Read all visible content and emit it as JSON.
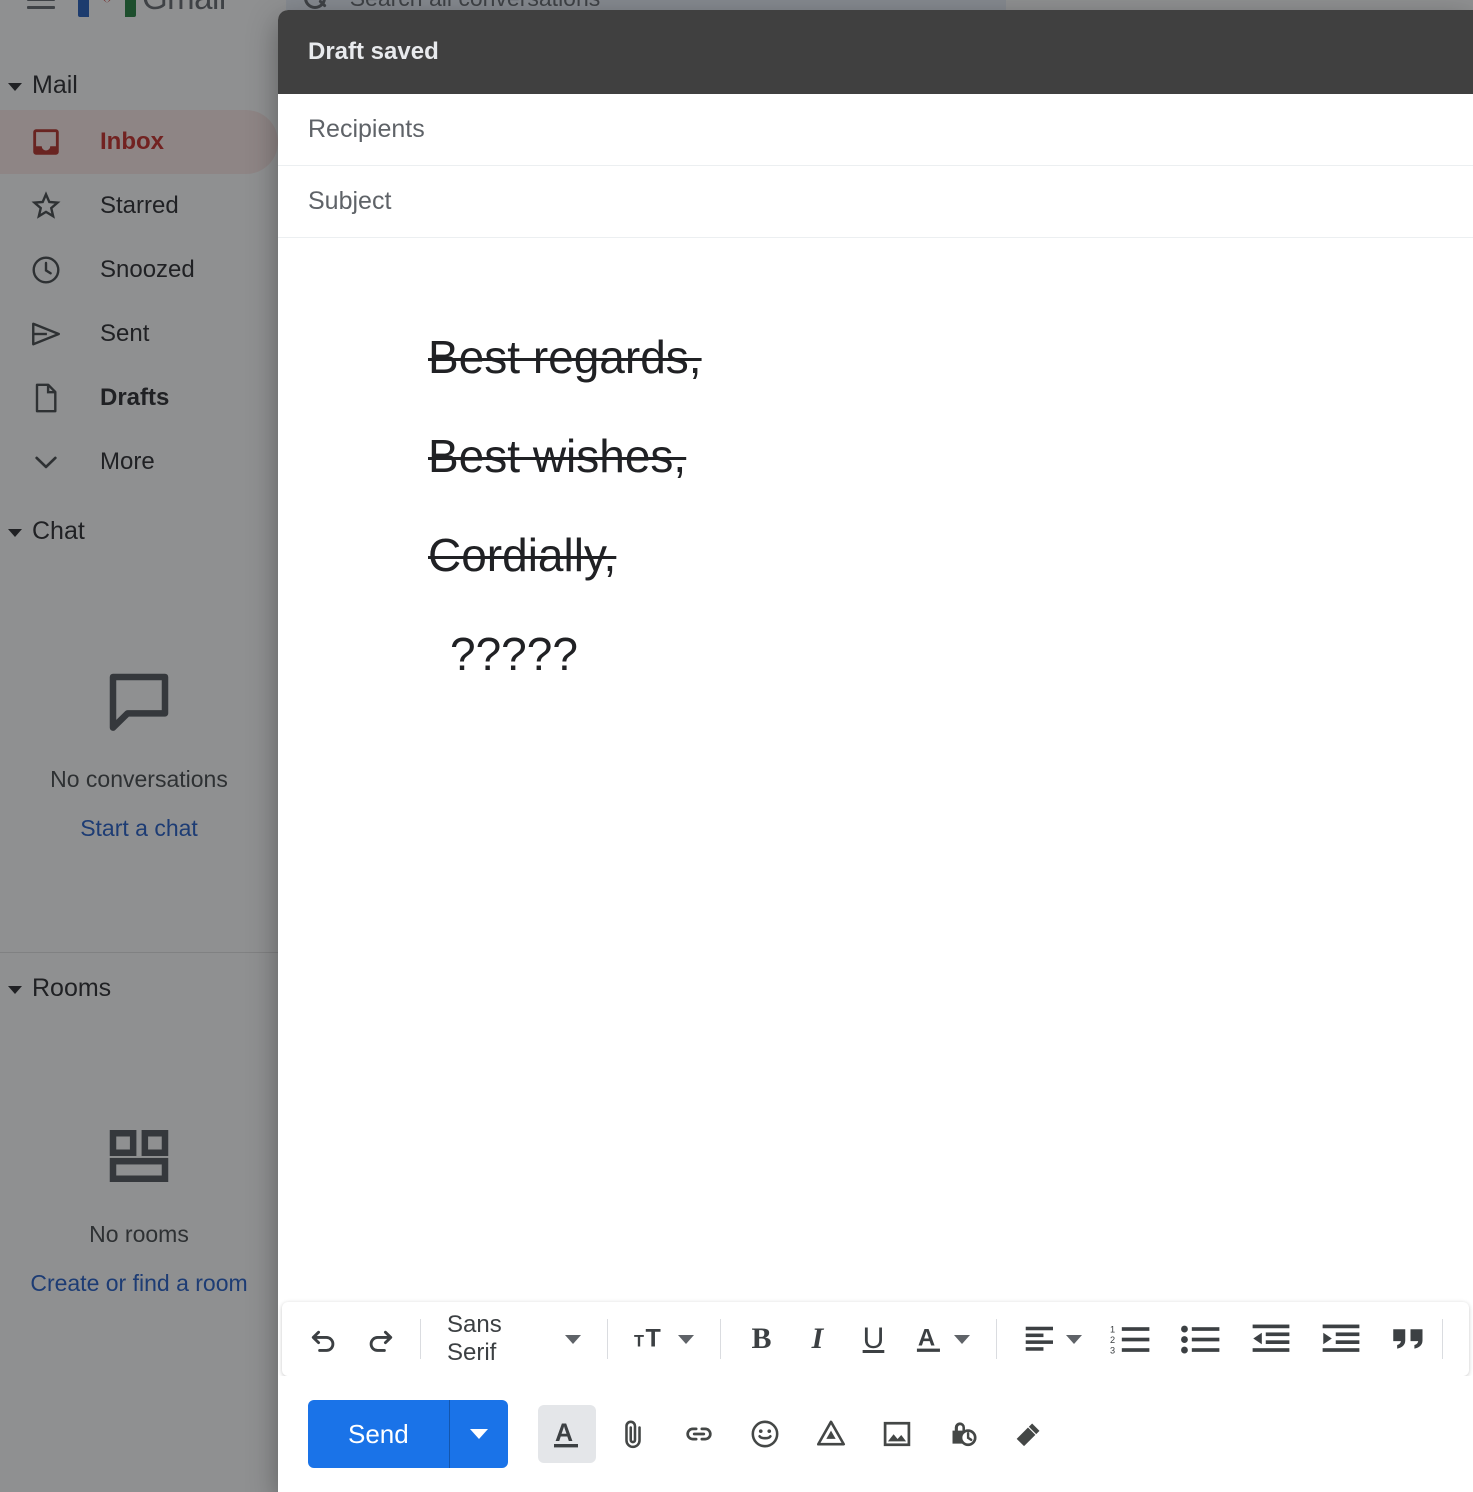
{
  "app": {
    "brand": "Gmail",
    "logo_colors": {
      "blue": "#1a56b8",
      "red": "#c5221f",
      "green": "#1a7a37"
    },
    "search": {
      "placeholder": "Search all conversations",
      "icon": "search-icon"
    },
    "menu_icon": "hamburger-menu-icon"
  },
  "sidebar": {
    "sections": [
      {
        "title": "Mail",
        "caret": "caret-down-icon"
      },
      {
        "title": "Chat",
        "caret": "caret-down-icon"
      },
      {
        "title": "Rooms",
        "caret": "caret-down-icon"
      }
    ],
    "mail_items": [
      {
        "label": "Inbox",
        "icon": "inbox-icon",
        "selected": true,
        "bold": true
      },
      {
        "label": "Starred",
        "icon": "star-icon",
        "selected": false,
        "bold": false
      },
      {
        "label": "Snoozed",
        "icon": "clock-icon",
        "selected": false,
        "bold": false
      },
      {
        "label": "Sent",
        "icon": "send-icon",
        "selected": false,
        "bold": false
      },
      {
        "label": "Drafts",
        "icon": "draft-icon",
        "selected": false,
        "bold": true
      },
      {
        "label": "More",
        "icon": "chevron-down-icon",
        "selected": false,
        "bold": false
      }
    ],
    "chat_empty": {
      "icon": "chat-bubble-icon",
      "text": "No conversations",
      "link": "Start a chat"
    },
    "rooms_empty": {
      "icon": "rooms-grid-icon",
      "text": "No rooms",
      "link": "Create or find a room"
    },
    "accent_selected_text": "#c5221f",
    "accent_link": "#1a56c4"
  },
  "compose": {
    "header_title": "Draft saved",
    "header_bg": "#404040",
    "recipients": {
      "placeholder": "Recipients",
      "value": ""
    },
    "subject": {
      "placeholder": "Subject",
      "value": ""
    },
    "body_lines": [
      {
        "text": "Best regards,",
        "strikethrough": true,
        "indented": false
      },
      {
        "text": "Best wishes,",
        "strikethrough": true,
        "indented": false
      },
      {
        "text": "Cordially,",
        "strikethrough": true,
        "indented": false
      },
      {
        "text": "?????",
        "strikethrough": false,
        "indented": true
      }
    ],
    "format_toolbar": {
      "undo": "undo-icon",
      "redo": "redo-icon",
      "font_name": "Sans Serif",
      "font_dropdown": "chevron-down-icon",
      "font_size": "format-size-icon",
      "font_size_dropdown": "chevron-down-icon",
      "bold": "B",
      "italic": "I",
      "underline": "U",
      "text_color": "text-color-icon",
      "text_color_dropdown": "chevron-down-icon",
      "align": "align-left-icon",
      "align_dropdown": "chevron-down-icon",
      "numbered_list": "numbered-list-icon",
      "bulleted_list": "bulleted-list-icon",
      "indent_less": "indent-decrease-icon",
      "indent_more": "indent-increase-icon",
      "quote": "block-quote-icon"
    },
    "send": {
      "label": "Send",
      "dropdown": "caret-down-icon",
      "accent": "#1a73e8"
    },
    "bottom_icons": [
      {
        "name": "formatting-options-icon",
        "active": true
      },
      {
        "name": "attach-file-icon",
        "active": false
      },
      {
        "name": "insert-link-icon",
        "active": false
      },
      {
        "name": "insert-emoji-icon",
        "active": false
      },
      {
        "name": "insert-drive-icon",
        "active": false
      },
      {
        "name": "insert-photo-icon",
        "active": false
      },
      {
        "name": "confidential-mode-icon",
        "active": false
      },
      {
        "name": "insert-signature-icon",
        "active": false
      }
    ]
  }
}
